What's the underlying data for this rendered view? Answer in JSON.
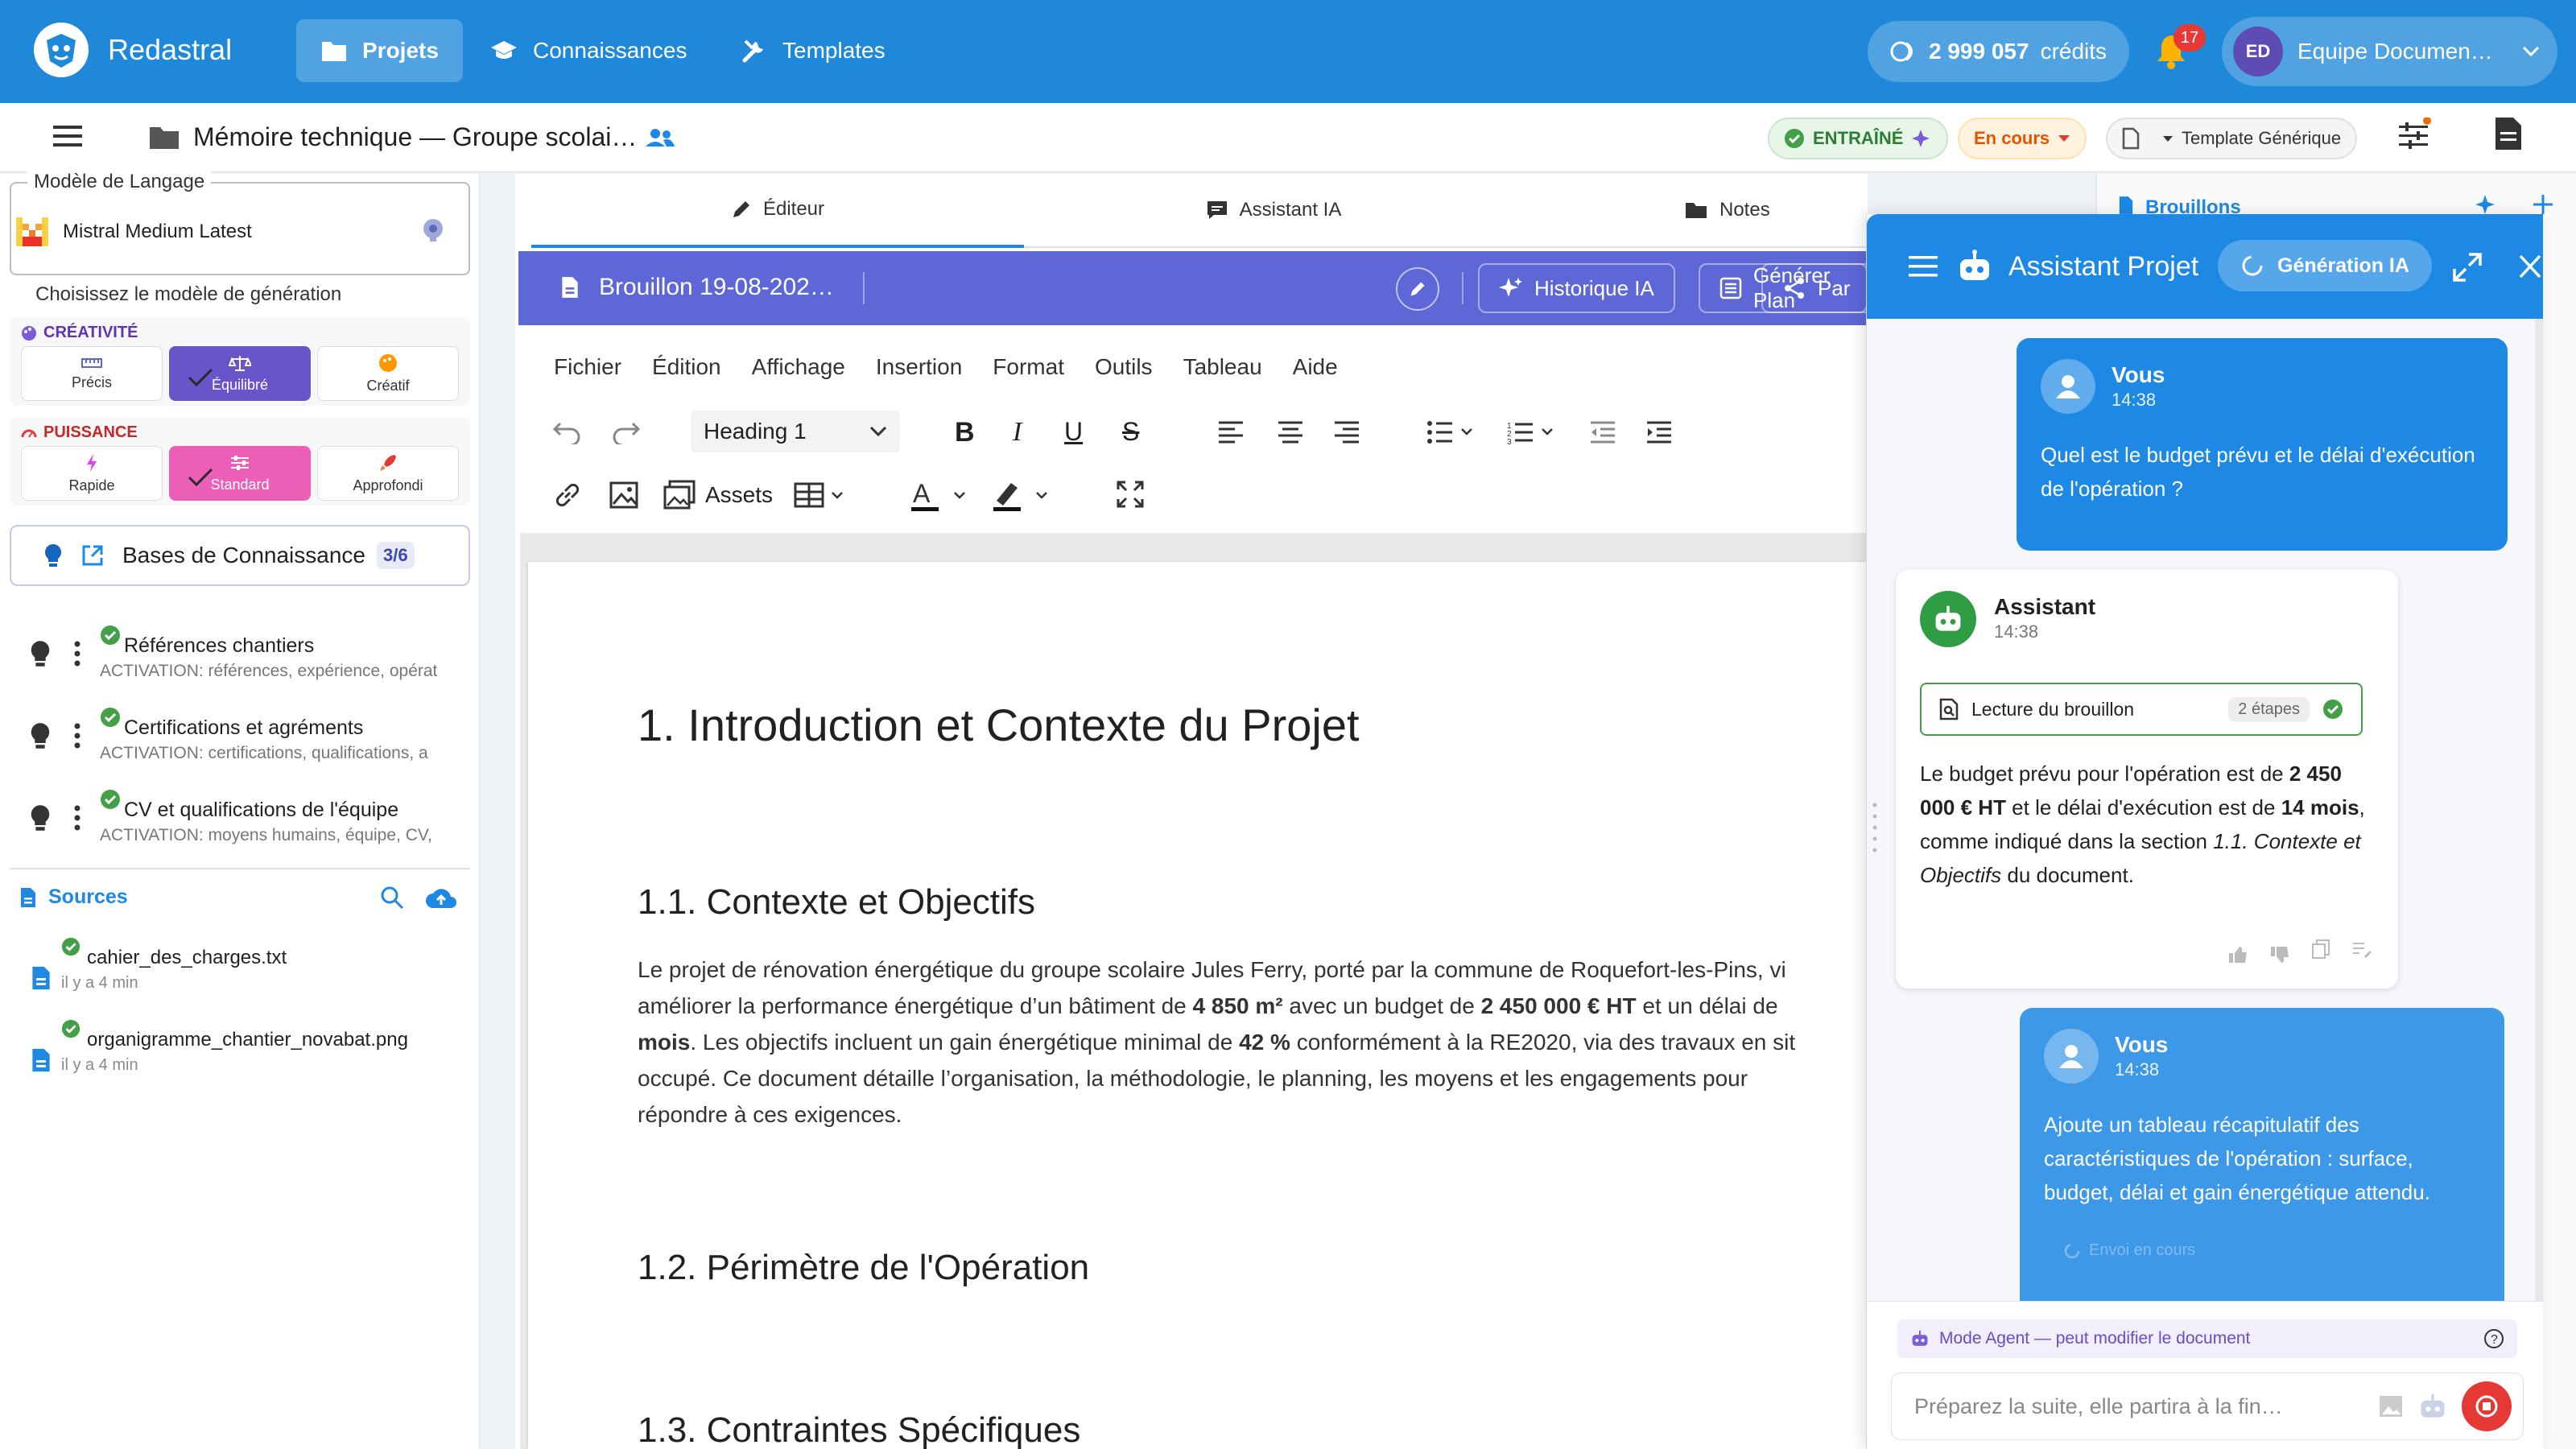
{
  "app": {
    "name": "Redastral",
    "nav": [
      {
        "label": "Projets"
      },
      {
        "label": "Connaissances"
      },
      {
        "label": "Templates"
      }
    ],
    "credits_value": "2 999 057",
    "credits_unit": "crédits",
    "notifications_count": "17",
    "user_initials": "ED",
    "user_name": "Equipe Documen…"
  },
  "document": {
    "title": "Mémoire technique — Groupe scolai…",
    "status_trained": "ENTRAÎNÉ",
    "status_progress": "En cours",
    "template": "Template Générique"
  },
  "left": {
    "model_legend": "Modèle de Langage",
    "model_name": "Mistral Medium Latest",
    "model_hint": "Choisissez le modèle de génération",
    "creativity_title": "CRÉATIVITÉ",
    "creativity_options": [
      "Précis",
      "Équilibré",
      "Créatif"
    ],
    "power_title": "PUISSANCE",
    "power_options": [
      "Rapide",
      "Standard",
      "Approfondi"
    ],
    "kb_label": "Bases de Connaissance",
    "kb_count": "3/6",
    "kb_items": [
      {
        "title": "Références chantiers",
        "activation": "ACTIVATION: références, expérience, opérat"
      },
      {
        "title": "Certifications et agréments",
        "activation": "ACTIVATION: certifications, qualifications, a"
      },
      {
        "title": "CV et qualifications de l'équipe",
        "activation": "ACTIVATION: moyens humains, équipe, CV,"
      }
    ],
    "sources_label": "Sources",
    "sources": [
      {
        "name": "cahier_des_charges.txt",
        "time": "il y a 4 min"
      },
      {
        "name": "organigramme_chantier_novabat.png",
        "time": "il y a 4 min"
      }
    ]
  },
  "editor": {
    "tabs": [
      "Éditeur",
      "Assistant IA",
      "Notes"
    ],
    "draft_title": "Brouillon 19-08-202…",
    "btn_history": "Historique IA",
    "btn_plan": "Générer Plan",
    "btn_share": "Par",
    "menu": [
      "Fichier",
      "Édition",
      "Affichage",
      "Insertion",
      "Format",
      "Outils",
      "Tableau",
      "Aide"
    ],
    "heading_select": "Heading 1",
    "assets_label": "Assets",
    "drafts_label": "Brouillons"
  },
  "doc": {
    "h1": "1. Introduction et Contexte du Projet",
    "h2_1": "1.1. Contexte et Objectifs",
    "p_a": "Le projet de rénovation énergétique du groupe scolaire Jules Ferry, porté par la commune de Roquefort-les-Pins, vi",
    "p_b1": "améliorer la performance énergétique d’un bâtiment de ",
    "p_b2": "4 850 m²",
    "p_b3": " avec un budget de ",
    "p_b4": "2 450 000 € HT",
    "p_b5": " et un délai de",
    "p_c1": "mois",
    "p_c2": ". Les objectifs incluent un gain énergétique minimal de ",
    "p_c3": "42 %",
    "p_c4": " conformément à la RE2020, via des travaux en sit",
    "p_d": "occupé. Ce document détaille l’organisation, la méthodologie, le planning, les moyens et les engagements pour",
    "p_e": "répondre à ces exigences.",
    "h2_2": "1.2. Périmètre de l'Opération",
    "h2_3": "1.3. Contraintes Spécifiques"
  },
  "assistant": {
    "title": "Assistant Projet",
    "generation_badge": "Génération IA",
    "msg1_author": "Vous",
    "msg1_time": "14:38",
    "msg1_text": "Quel est le budget prévu et le délai d'exécution de l'opération ?",
    "msg2_author": "Assistant",
    "msg2_time": "14:38",
    "step_label": "Lecture du brouillon",
    "step_count": "2 étapes",
    "ans_1": "Le budget prévu pour l'opération est de ",
    "ans_2": "2 450 000 € HT",
    "ans_3": " et le délai d'exécution est de ",
    "ans_4": "14 mois",
    "ans_5": ", comme indiqué dans la section ",
    "ans_6": "1.1. Contexte et Objectifs",
    "ans_7": " du document.",
    "msg3_author": "Vous",
    "msg3_time": "14:38",
    "msg3_text": "Ajoute un tableau récapitulatif des caractéristiques de l'opération : surface, budget, délai et gain énergétique attendu.",
    "msg3_status": "Envoi en cours",
    "agent_mode": "Mode Agent — peut modifier le document",
    "input_placeholder": "Préparez la suite, elle partira à la fin…"
  },
  "colors": {
    "brand": "#1f88d9",
    "accent_purple": "#5e67d6",
    "success": "#43a047",
    "danger": "#e53935"
  }
}
